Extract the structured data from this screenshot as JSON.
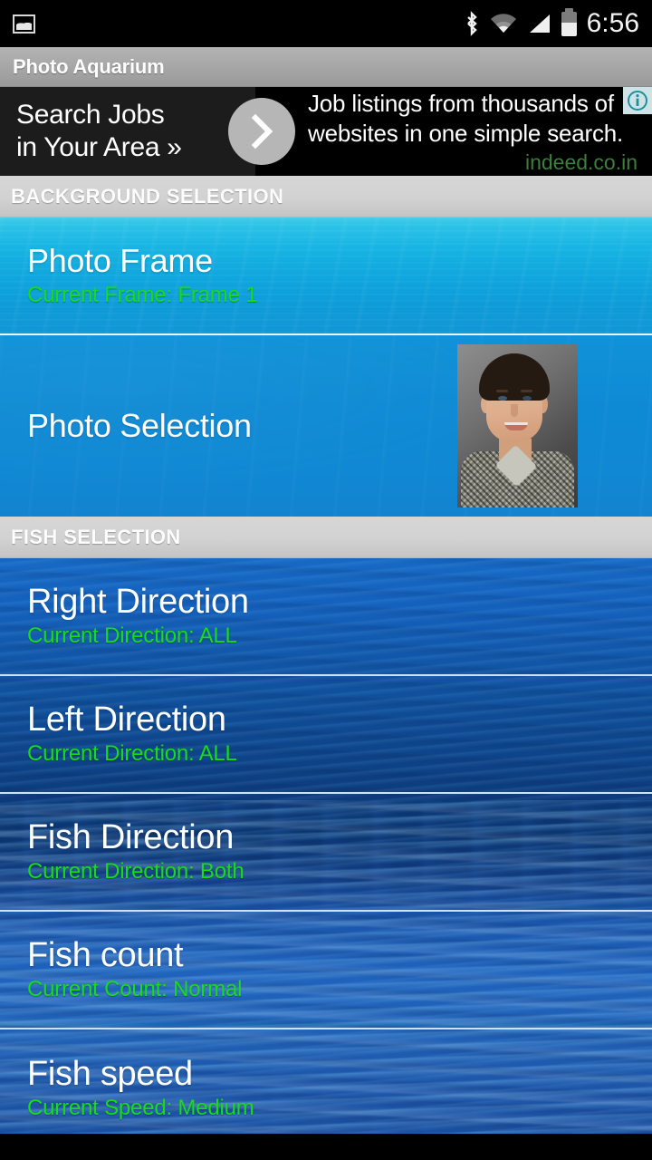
{
  "status_bar": {
    "notification_icon": "photo-icon",
    "icons": [
      "bluetooth-icon",
      "wifi-icon",
      "cell-signal-icon",
      "battery-icon"
    ],
    "time": "6:56"
  },
  "title_bar": {
    "title": "Photo Aquarium"
  },
  "ad": {
    "cta_line1": "Search Jobs",
    "cta_line2": "in Your Area »",
    "arrow_icon": "chevron-right-icon",
    "body_line1": "Job listings from thousands of",
    "body_line2": "websites in one simple search.",
    "url": "indeed.co.in",
    "info_icon": "ad-choices-info-icon"
  },
  "sections": [
    {
      "header": "BACKGROUND SELECTION",
      "rows": [
        {
          "title": "Photo Frame",
          "subtitle": "Current Frame: Frame 1"
        },
        {
          "title": "Photo Selection",
          "subtitle": "",
          "thumbnail": "portrait-photo-thumbnail"
        }
      ]
    },
    {
      "header": "FISH SELECTION",
      "rows": [
        {
          "title": "Right Direction",
          "subtitle": "Current Direction: ALL"
        },
        {
          "title": "Left Direction",
          "subtitle": "Current Direction: ALL"
        },
        {
          "title": "Fish Direction",
          "subtitle": "Current Direction: Both"
        },
        {
          "title": "Fish count",
          "subtitle": "Current Count: Normal"
        },
        {
          "title": "Fish speed",
          "subtitle": "Current Speed: Medium"
        }
      ]
    }
  ],
  "colors": {
    "accent_green": "#18dc18",
    "title_white": "#ffffff",
    "status_bar_bg": "#000000",
    "title_bar_bg": "#a8a8a8",
    "section_header_bg": "#d2d2d2",
    "ad_bg": "#000000",
    "ad_url_green": "#3a7f3a"
  }
}
